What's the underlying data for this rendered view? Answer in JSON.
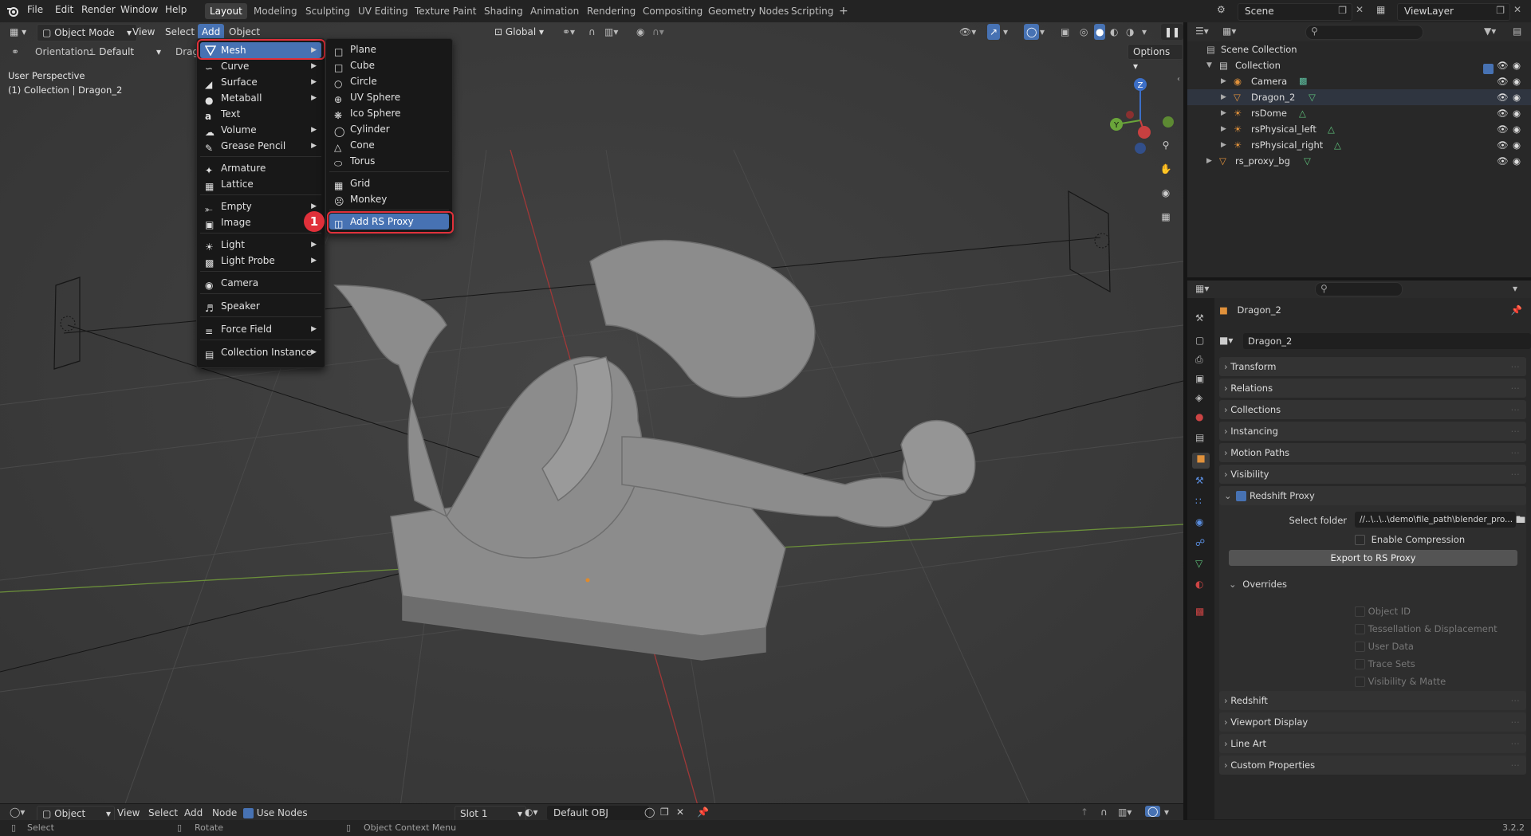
{
  "topbar": {
    "menus": [
      "File",
      "Edit",
      "Render",
      "Window",
      "Help"
    ],
    "workspaces": [
      "Layout",
      "Modeling",
      "Sculpting",
      "UV Editing",
      "Texture Paint",
      "Shading",
      "Animation",
      "Rendering",
      "Compositing",
      "Geometry Nodes",
      "Scripting"
    ],
    "active_workspace": "Layout",
    "scene": "Scene",
    "view_layer": "ViewLayer"
  },
  "viewport": {
    "mode": "Object Mode",
    "menus": [
      "View",
      "Select",
      "Add",
      "Object"
    ],
    "transform_orientation": "Global",
    "orientation_label": "Orientation:",
    "orientation_value": "Default",
    "drag_label": "Drag",
    "options": "Options",
    "overlay_line1": "User Perspective",
    "overlay_line2": "(1) Collection | Dragon_2",
    "gizmo_axes": [
      "X",
      "Y",
      "Z"
    ]
  },
  "add_menu": {
    "items": [
      {
        "label": "Mesh",
        "icon": "mesh-icon",
        "submenu": true
      },
      {
        "label": "Curve",
        "icon": "curve-icon",
        "submenu": true
      },
      {
        "label": "Surface",
        "icon": "surface-icon",
        "submenu": true
      },
      {
        "label": "Metaball",
        "icon": "metaball-icon",
        "submenu": true
      },
      {
        "label": "Text",
        "icon": "text-icon",
        "submenu": false
      },
      {
        "label": "Volume",
        "icon": "volume-icon",
        "submenu": true
      },
      {
        "label": "Grease Pencil",
        "icon": "grease-pencil-icon",
        "submenu": true
      },
      {
        "label": "Armature",
        "icon": "armature-icon",
        "submenu": false
      },
      {
        "label": "Lattice",
        "icon": "lattice-icon",
        "submenu": false
      },
      {
        "label": "Empty",
        "icon": "empty-icon",
        "submenu": true
      },
      {
        "label": "Image",
        "icon": "image-icon",
        "submenu": true
      },
      {
        "label": "Light",
        "icon": "light-icon",
        "submenu": true
      },
      {
        "label": "Light Probe",
        "icon": "light-probe-icon",
        "submenu": true
      },
      {
        "label": "Camera",
        "icon": "camera-icon",
        "submenu": false
      },
      {
        "label": "Speaker",
        "icon": "speaker-icon",
        "submenu": false
      },
      {
        "label": "Force Field",
        "icon": "force-field-icon",
        "submenu": true
      },
      {
        "label": "Collection Instance",
        "icon": "collection-instance-icon",
        "submenu": true
      }
    ]
  },
  "mesh_submenu": {
    "items": [
      "Plane",
      "Cube",
      "Circle",
      "UV Sphere",
      "Ico Sphere",
      "Cylinder",
      "Cone",
      "Torus",
      "Grid",
      "Monkey",
      "Add RS Proxy"
    ]
  },
  "step_badge": "1",
  "outliner": {
    "root": "Scene Collection",
    "collection": "Collection",
    "items": [
      "Camera",
      "Dragon_2",
      "rsDome",
      "rsPhysical_left",
      "rsPhysical_right"
    ],
    "extra": "rs_proxy_bg"
  },
  "properties": {
    "object_name": "Dragon_2",
    "object_field": "Dragon_2",
    "panels": [
      "Transform",
      "Relations",
      "Collections",
      "Instancing",
      "Motion Paths",
      "Visibility"
    ],
    "redshift_proxy": {
      "title": "Redshift Proxy",
      "select_folder_label": "Select folder",
      "select_folder_value": "//..\\..\\..\\demo\\file_path\\blender_pro...",
      "enable_compression": "Enable Compression",
      "export_button": "Export to RS Proxy",
      "overrides_title": "Overrides",
      "overrides": [
        "Object ID",
        "Tessellation & Displacement",
        "User Data",
        "Trace Sets",
        "Visibility & Matte"
      ]
    },
    "panels_bottom": [
      "Redshift",
      "Viewport Display",
      "Line Art",
      "Custom Properties"
    ]
  },
  "bottom": {
    "mode": "Object",
    "menus": [
      "View",
      "Select",
      "Add",
      "Node"
    ],
    "use_nodes": "Use Nodes",
    "slot": "Slot 1",
    "material": "Default OBJ"
  },
  "status": {
    "select": "Select",
    "rotate": "Rotate",
    "context_menu": "Object Context Menu",
    "version": "3.2.2"
  },
  "colors": {
    "accent": "#4772b3",
    "highlight_red": "#e0303a",
    "viewport_bg": "#3d3d3d"
  }
}
